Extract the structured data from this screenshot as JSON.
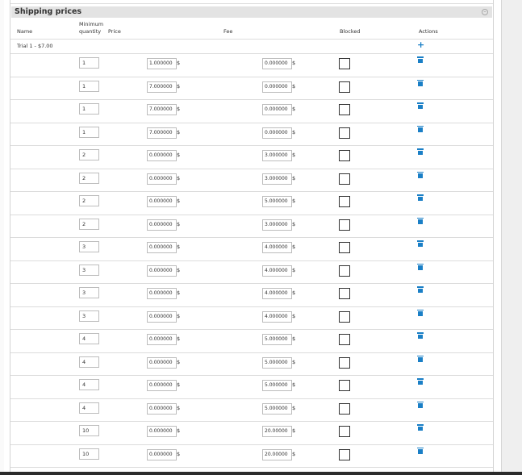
{
  "panel": {
    "title": "Shipping prices",
    "collapse_icon": "collapse-icon"
  },
  "columns": {
    "name": "Name",
    "min_quantity_line1": "Minimum",
    "min_quantity_line2": "quantity",
    "price": "Price",
    "fee": "Fee",
    "blocked": "Blocked",
    "actions": "Actions"
  },
  "group": {
    "label": "Trial 1 - $7.00",
    "add_icon": "plus-icon"
  },
  "currency": "$",
  "rows": [
    {
      "qty": "1",
      "price": "1.000000",
      "fee": "0.000000",
      "blocked": false
    },
    {
      "qty": "1",
      "price": "7.000000",
      "fee": "0.000000",
      "blocked": false
    },
    {
      "qty": "1",
      "price": "7.000000",
      "fee": "0.000000",
      "blocked": false
    },
    {
      "qty": "1",
      "price": "7.000000",
      "fee": "0.000000",
      "blocked": false
    },
    {
      "qty": "2",
      "price": "0.000000",
      "fee": "3.000000",
      "blocked": false
    },
    {
      "qty": "2",
      "price": "0.000000",
      "fee": "3.000000",
      "blocked": false
    },
    {
      "qty": "2",
      "price": "0.000000",
      "fee": "5.000000",
      "blocked": false
    },
    {
      "qty": "2",
      "price": "0.000000",
      "fee": "3.000000",
      "blocked": false
    },
    {
      "qty": "3",
      "price": "0.000000",
      "fee": "4.000000",
      "blocked": false
    },
    {
      "qty": "3",
      "price": "0.000000",
      "fee": "4.000000",
      "blocked": false
    },
    {
      "qty": "3",
      "price": "0.000000",
      "fee": "4.000000",
      "blocked": false
    },
    {
      "qty": "3",
      "price": "0.000000",
      "fee": "4.000000",
      "blocked": false
    },
    {
      "qty": "4",
      "price": "0.000000",
      "fee": "5.000000",
      "blocked": false
    },
    {
      "qty": "4",
      "price": "0.000000",
      "fee": "5.000000",
      "blocked": false
    },
    {
      "qty": "4",
      "price": "0.000000",
      "fee": "5.000000",
      "blocked": false
    },
    {
      "qty": "4",
      "price": "0.000000",
      "fee": "5.000000",
      "blocked": false
    },
    {
      "qty": "10",
      "price": "0.000000",
      "fee": "20.00000",
      "blocked": false
    },
    {
      "qty": "10",
      "price": "0.000000",
      "fee": "20.00000",
      "blocked": false
    }
  ],
  "row_action_icon": "trash-icon",
  "colors": {
    "accent": "#1a7fc6",
    "header_bg": "#e3e3e3",
    "border": "#dcdcdc"
  }
}
